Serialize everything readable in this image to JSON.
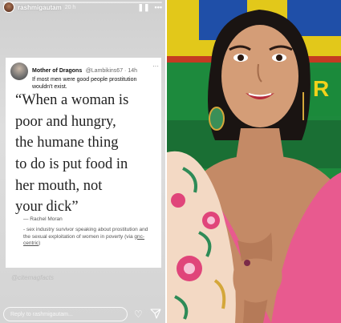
{
  "story": {
    "username": "rashmigautam",
    "time": "20 h",
    "pause_icon": "pause-icon",
    "more_icon": "more-icon"
  },
  "tweet": {
    "name": "Mother of Dragons",
    "handle": "@Lambikins67 · 14h",
    "text": "If most men were good people prostitution wouldn't exist.",
    "quote_lines": [
      "“When a woman is",
      "poor and hungry,",
      "the humane thing",
      "to do is put food in",
      "her mouth, not",
      "your dick”"
    ],
    "attribution_name": "— Rachel Moran",
    "attribution_desc": "- sex industry survivor speaking about prostitution and the sexual exploitation of women in poverty (via",
    "attribution_link": "gnc-centric",
    "attribution_close": ")"
  },
  "sticker": "@citemagfacts",
  "reply": {
    "placeholder": "Reply to rashmigautam...",
    "like_icon": "heart-icon",
    "send_icon": "send-icon"
  },
  "colors": {
    "accent_green": "#1d8a3d",
    "accent_yellow": "#f2d21b",
    "dress_pink": "#e85a8f"
  }
}
